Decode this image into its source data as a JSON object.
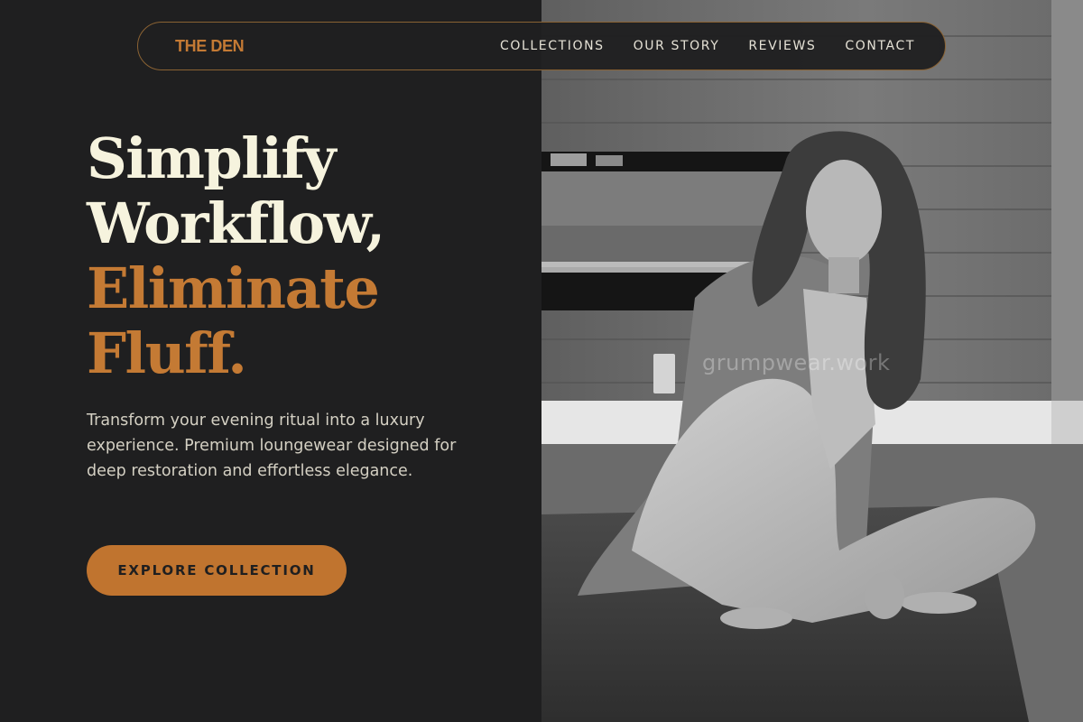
{
  "brand": {
    "logo_text": "THE DEN",
    "accent_color": "#c47a34",
    "text_light_color": "#f6f3de",
    "background_color": "#1f1f20"
  },
  "nav": {
    "links": [
      {
        "label": "COLLECTIONS"
      },
      {
        "label": "OUR STORY"
      },
      {
        "label": "REVIEWS"
      },
      {
        "label": "CONTACT"
      }
    ]
  },
  "hero": {
    "headline_lines": [
      "Simplify",
      "Workflow,",
      "Eliminate",
      "Fluff."
    ],
    "subtext": "Transform your evening ritual into a luxury experience. Premium loungewear designed for deep restoration and effortless elegance.",
    "cta_label": "EXPLORE COLLECTION"
  },
  "photo": {
    "watermark": "grumpwear.work"
  }
}
